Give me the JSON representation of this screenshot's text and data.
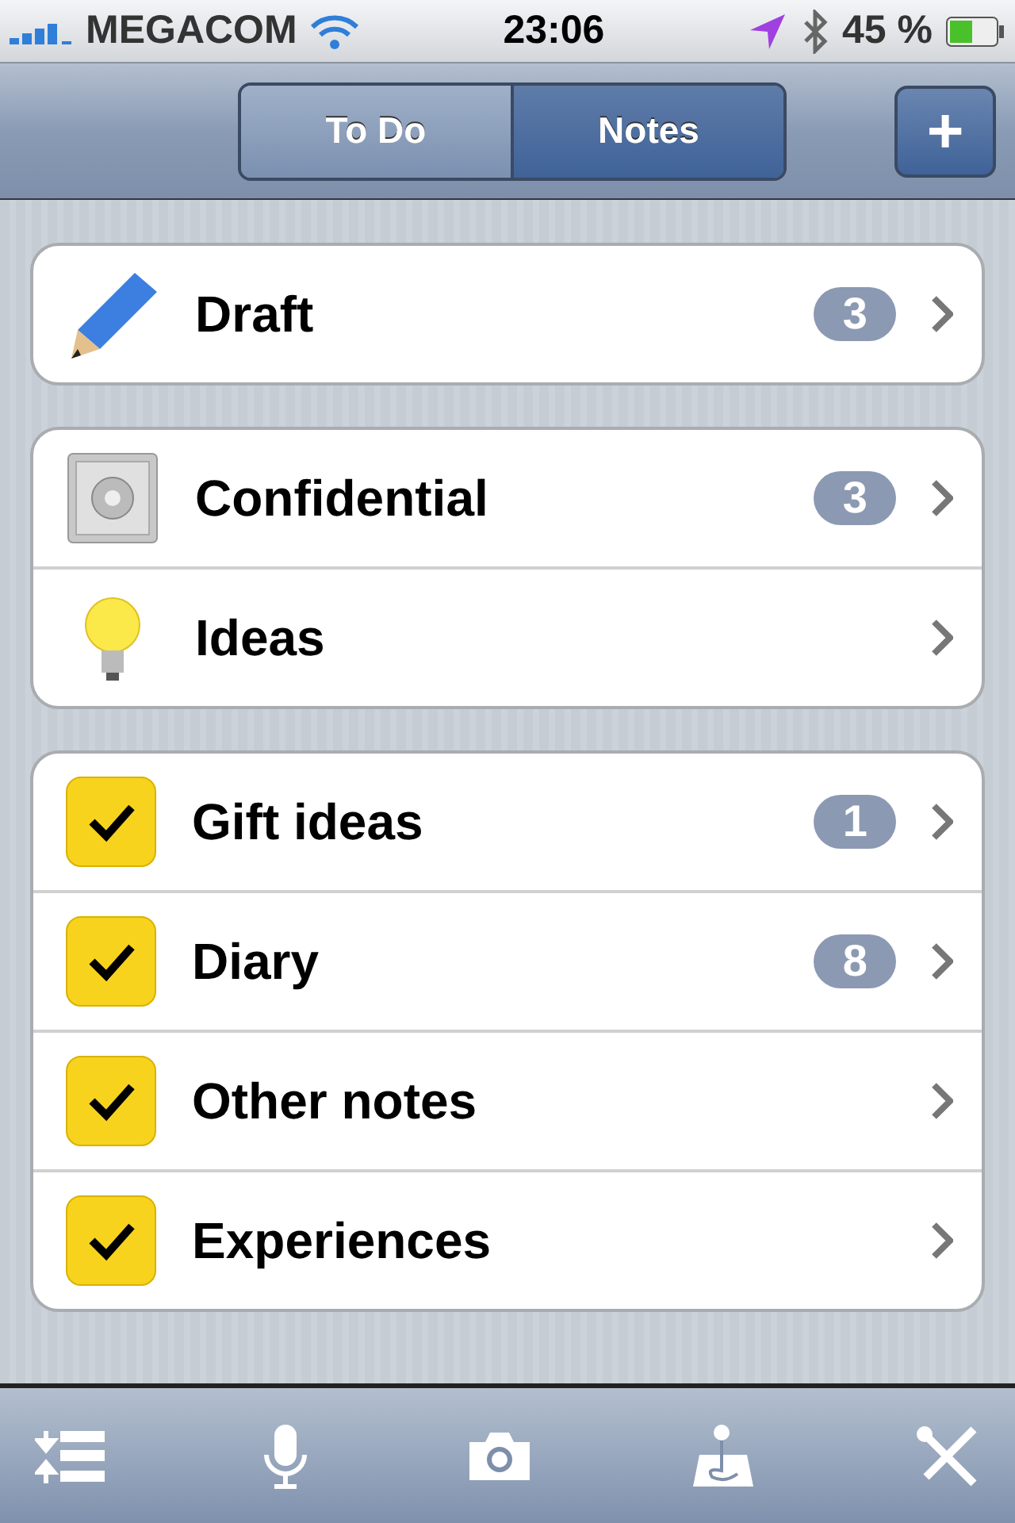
{
  "status_bar": {
    "carrier": "MEGACOM",
    "time": "23:06",
    "battery": "45 %"
  },
  "segments": [
    {
      "label": "To Do",
      "selected": false
    },
    {
      "label": "Notes",
      "selected": true
    }
  ],
  "add_button": "+",
  "groups": [
    {
      "items": [
        {
          "kind": "pencil",
          "title": "Draft",
          "badge": "3"
        }
      ]
    },
    {
      "items": [
        {
          "kind": "safe",
          "title": "Confidential",
          "badge": "3"
        },
        {
          "kind": "bulb",
          "title": "Ideas"
        }
      ]
    },
    {
      "items": [
        {
          "kind": "check",
          "title": "Gift ideas",
          "badge": "1"
        },
        {
          "kind": "check",
          "title": "Diary",
          "badge": "8"
        },
        {
          "kind": "check",
          "title": "Other notes"
        },
        {
          "kind": "check",
          "title": "Experiences"
        }
      ]
    }
  ]
}
